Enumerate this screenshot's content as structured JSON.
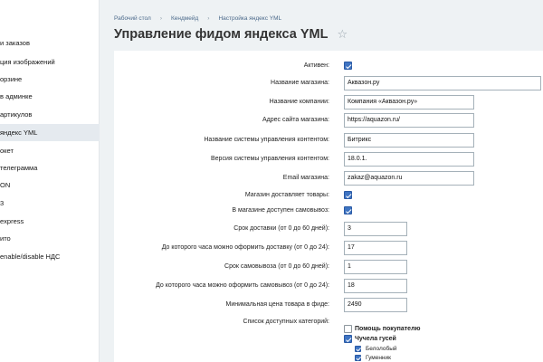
{
  "sidebar": {
    "items": [
      {
        "label": "и заказов"
      },
      {
        "label": "ция изображений"
      },
      {
        "label": "орзине"
      },
      {
        "label": "в админке"
      },
      {
        "label": "артикулов"
      },
      {
        "label": "яндекс YML"
      },
      {
        "label": "окет"
      },
      {
        "label": "телеграмма"
      },
      {
        "label": "ON"
      },
      {
        "label": "3"
      },
      {
        "label": "express"
      },
      {
        "label": "ито"
      },
      {
        "label": "enable/disable НДС"
      }
    ]
  },
  "breadcrumb": {
    "items": [
      "Рабочий стол",
      "Кендмейд",
      "Настройка яндекс YML"
    ],
    "separator": "›"
  },
  "page": {
    "title": "Управление фидом яндекса YML",
    "favorite_icon": "☆"
  },
  "form": {
    "active_label": "Активен:",
    "shop_name_label": "Название магазина:",
    "shop_name_value": "Аквазон.ру",
    "company_name_label": "Название компании:",
    "company_name_value": "Компания «Аквазон.ру»",
    "site_url_label": "Адрес сайта магазина:",
    "site_url_value": "https://aquazon.ru/",
    "cms_name_label": "Название системы управления контентом:",
    "cms_name_value": "Битрикс",
    "cms_version_label": "Версия системы управления контентом:",
    "cms_version_value": "18.0.1.",
    "email_label": "Email магазина:",
    "email_value": "zakaz@aquazon.ru",
    "delivery_label": "Магазин доставляет товары:",
    "pickup_label": "В магазине доступен самовывоз:",
    "delivery_days_label": "Срок доставки (от 0 до 60 дней):",
    "delivery_days_value": "3",
    "delivery_hour_label": "До которого часа можно оформить доставку (от 0 до 24):",
    "delivery_hour_value": "17",
    "pickup_days_label": "Срок самовывоза (от 0 до 60 дней):",
    "pickup_days_value": "1",
    "pickup_hour_label": "До которого часа можно оформить самовывоз (от 0 до 24):",
    "pickup_hour_value": "18",
    "min_price_label": "Минимальная цена товара в фиде:",
    "min_price_value": "2490",
    "categories_label": "Список доступных категорий:",
    "categories": [
      {
        "label": "Помощь покупателю",
        "checked": false,
        "level": 0
      },
      {
        "label": "Чучела гусей",
        "checked": true,
        "level": 0
      },
      {
        "label": "Белолобый",
        "checked": true,
        "level": 1
      },
      {
        "label": "Гуменник",
        "checked": true,
        "level": 1
      }
    ]
  },
  "colors": {
    "accent": "#3f74c2",
    "link": "#4c6a8b",
    "background": "#eef2f4"
  }
}
